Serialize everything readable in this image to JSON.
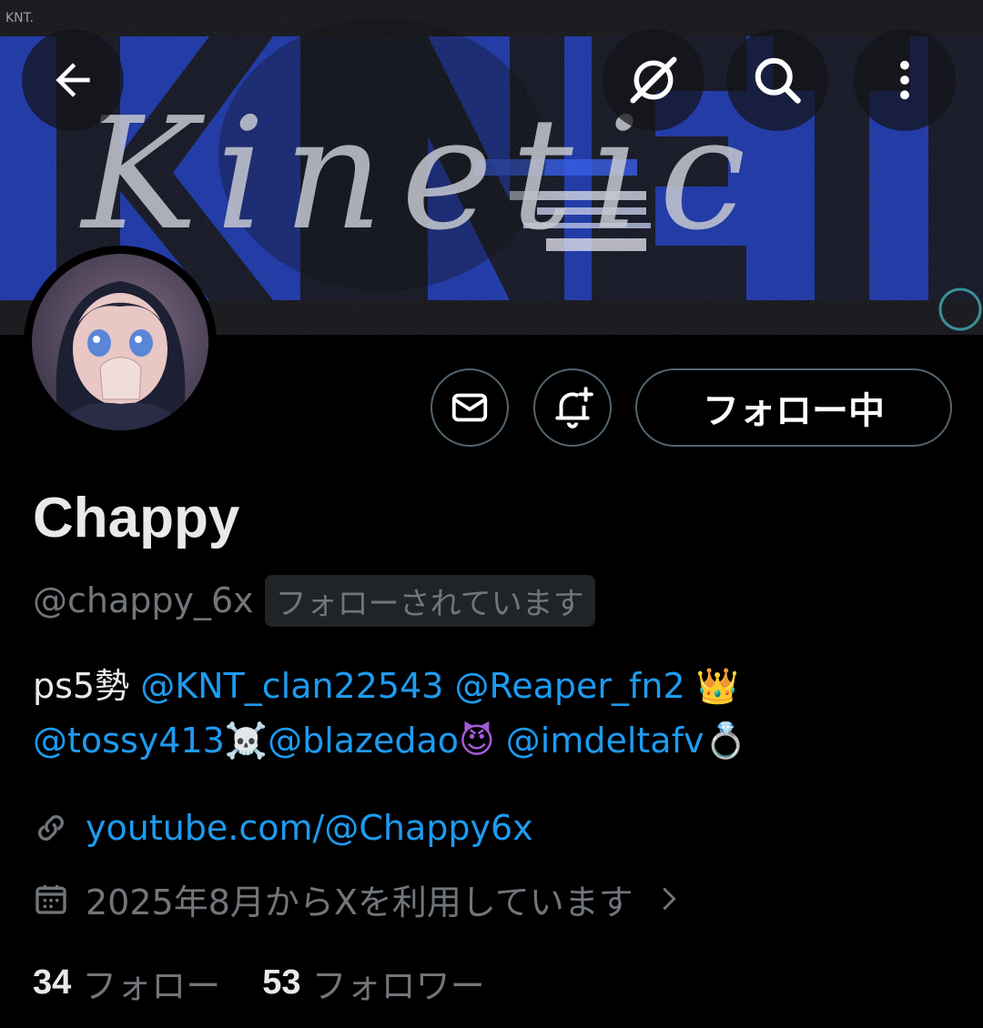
{
  "banner": {
    "tag": "KNT.",
    "script_text": "Kinetic",
    "block_text": "KNETIC"
  },
  "header": {
    "back_icon": "arrow-left-icon",
    "grok_icon": "grok-icon",
    "search_icon": "search-icon",
    "more_icon": "more-vertical-icon"
  },
  "actions": {
    "message_icon": "mail-icon",
    "notify_icon": "bell-plus-icon",
    "follow_label": "フォロー中"
  },
  "profile": {
    "name": "Chappy",
    "handle": "@chappy_6x",
    "follows_you": "フォローされています",
    "bio": {
      "prefix": "ps5勢 ",
      "mention1": "@KNT_clan22543",
      "mention2": "@Reaper_fn2",
      "emoji_crown": "👑",
      "mention3": "@tossy413",
      "emoji_skull": "☠️",
      "mention4": "@blazedao",
      "emoji_devil": "😈",
      "mention5": "@imdeltafv",
      "emoji_ring": "💍"
    },
    "link": "youtube.com/@Chappy6x",
    "joined": "2025年8月からXを利用しています",
    "following_count": "34",
    "following_label": "フォロー",
    "followers_count": "53",
    "followers_label": "フォロワー"
  },
  "colors": {
    "accent": "#1d9bf0",
    "banner_blue": "#1636b8",
    "muted": "#71767b"
  }
}
